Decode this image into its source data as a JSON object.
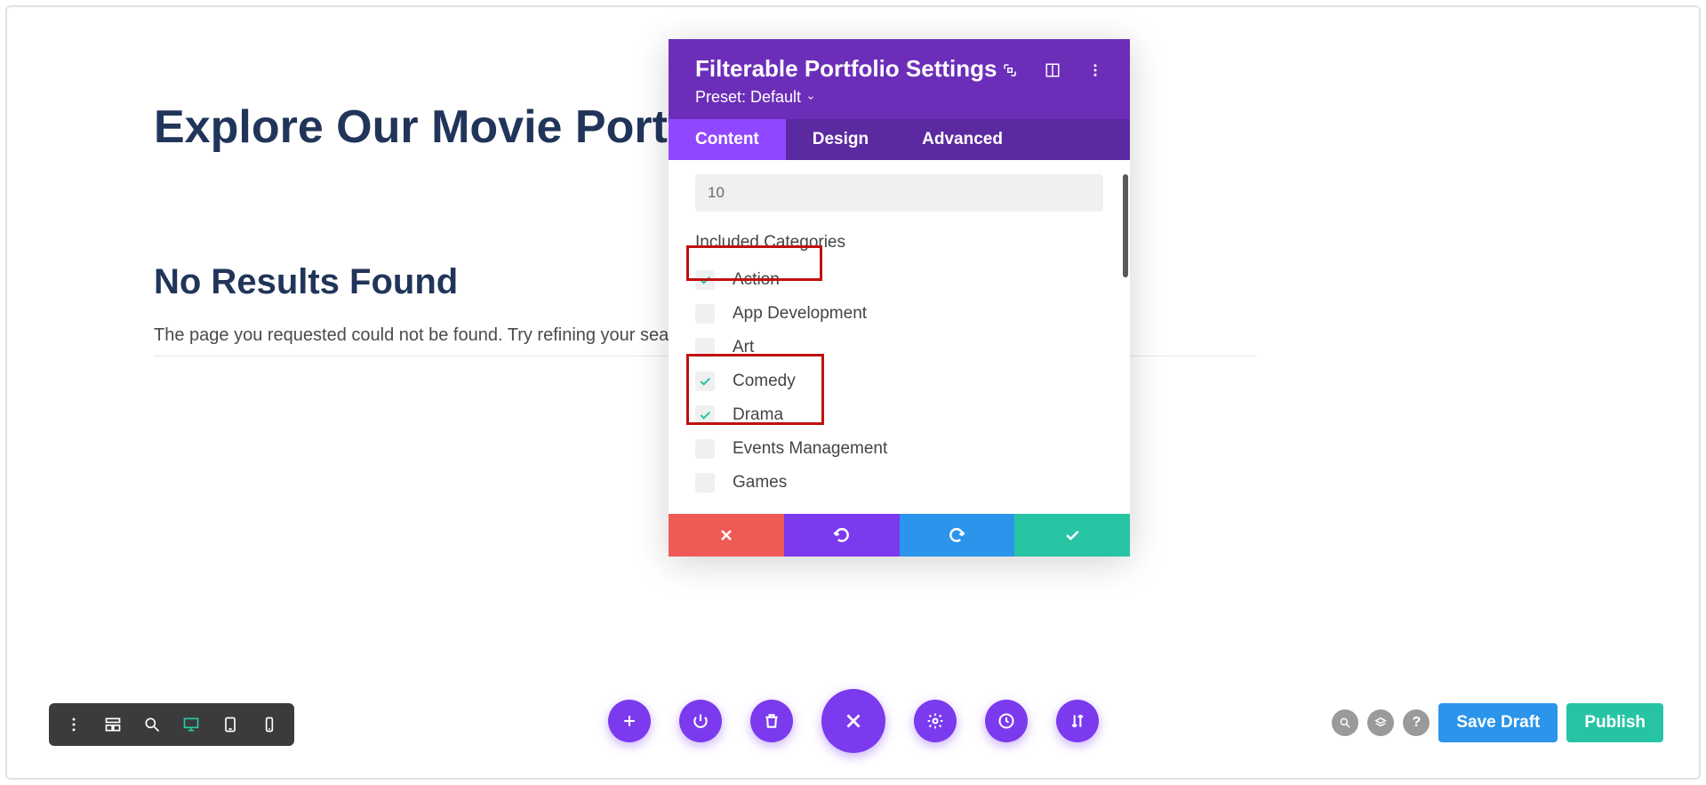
{
  "page": {
    "title": "Explore Our Movie Portfolio",
    "no_results_heading": "No Results Found",
    "no_results_text": "The page you requested could not be found. Try refining your search, or"
  },
  "panel": {
    "title": "Filterable Portfolio Settings",
    "preset_label": "Preset: Default",
    "tabs": {
      "content": "Content",
      "design": "Design",
      "advanced": "Advanced"
    },
    "count_value": "10",
    "categories_label": "Included Categories",
    "categories": [
      {
        "label": "Action",
        "checked": true
      },
      {
        "label": "App Development",
        "checked": false
      },
      {
        "label": "Art",
        "checked": false
      },
      {
        "label": "Comedy",
        "checked": true
      },
      {
        "label": "Drama",
        "checked": true
      },
      {
        "label": "Events Management",
        "checked": false
      },
      {
        "label": "Games",
        "checked": false
      }
    ]
  },
  "bottom_bar": {
    "save_draft": "Save Draft",
    "publish": "Publish"
  },
  "colors": {
    "panel_purple": "#6c2eb9",
    "tab_active": "#9147ff",
    "circle_purple": "#7b3aed",
    "teal": "#27c4a4",
    "blue": "#2b94eb",
    "red": "#ef5a56"
  }
}
